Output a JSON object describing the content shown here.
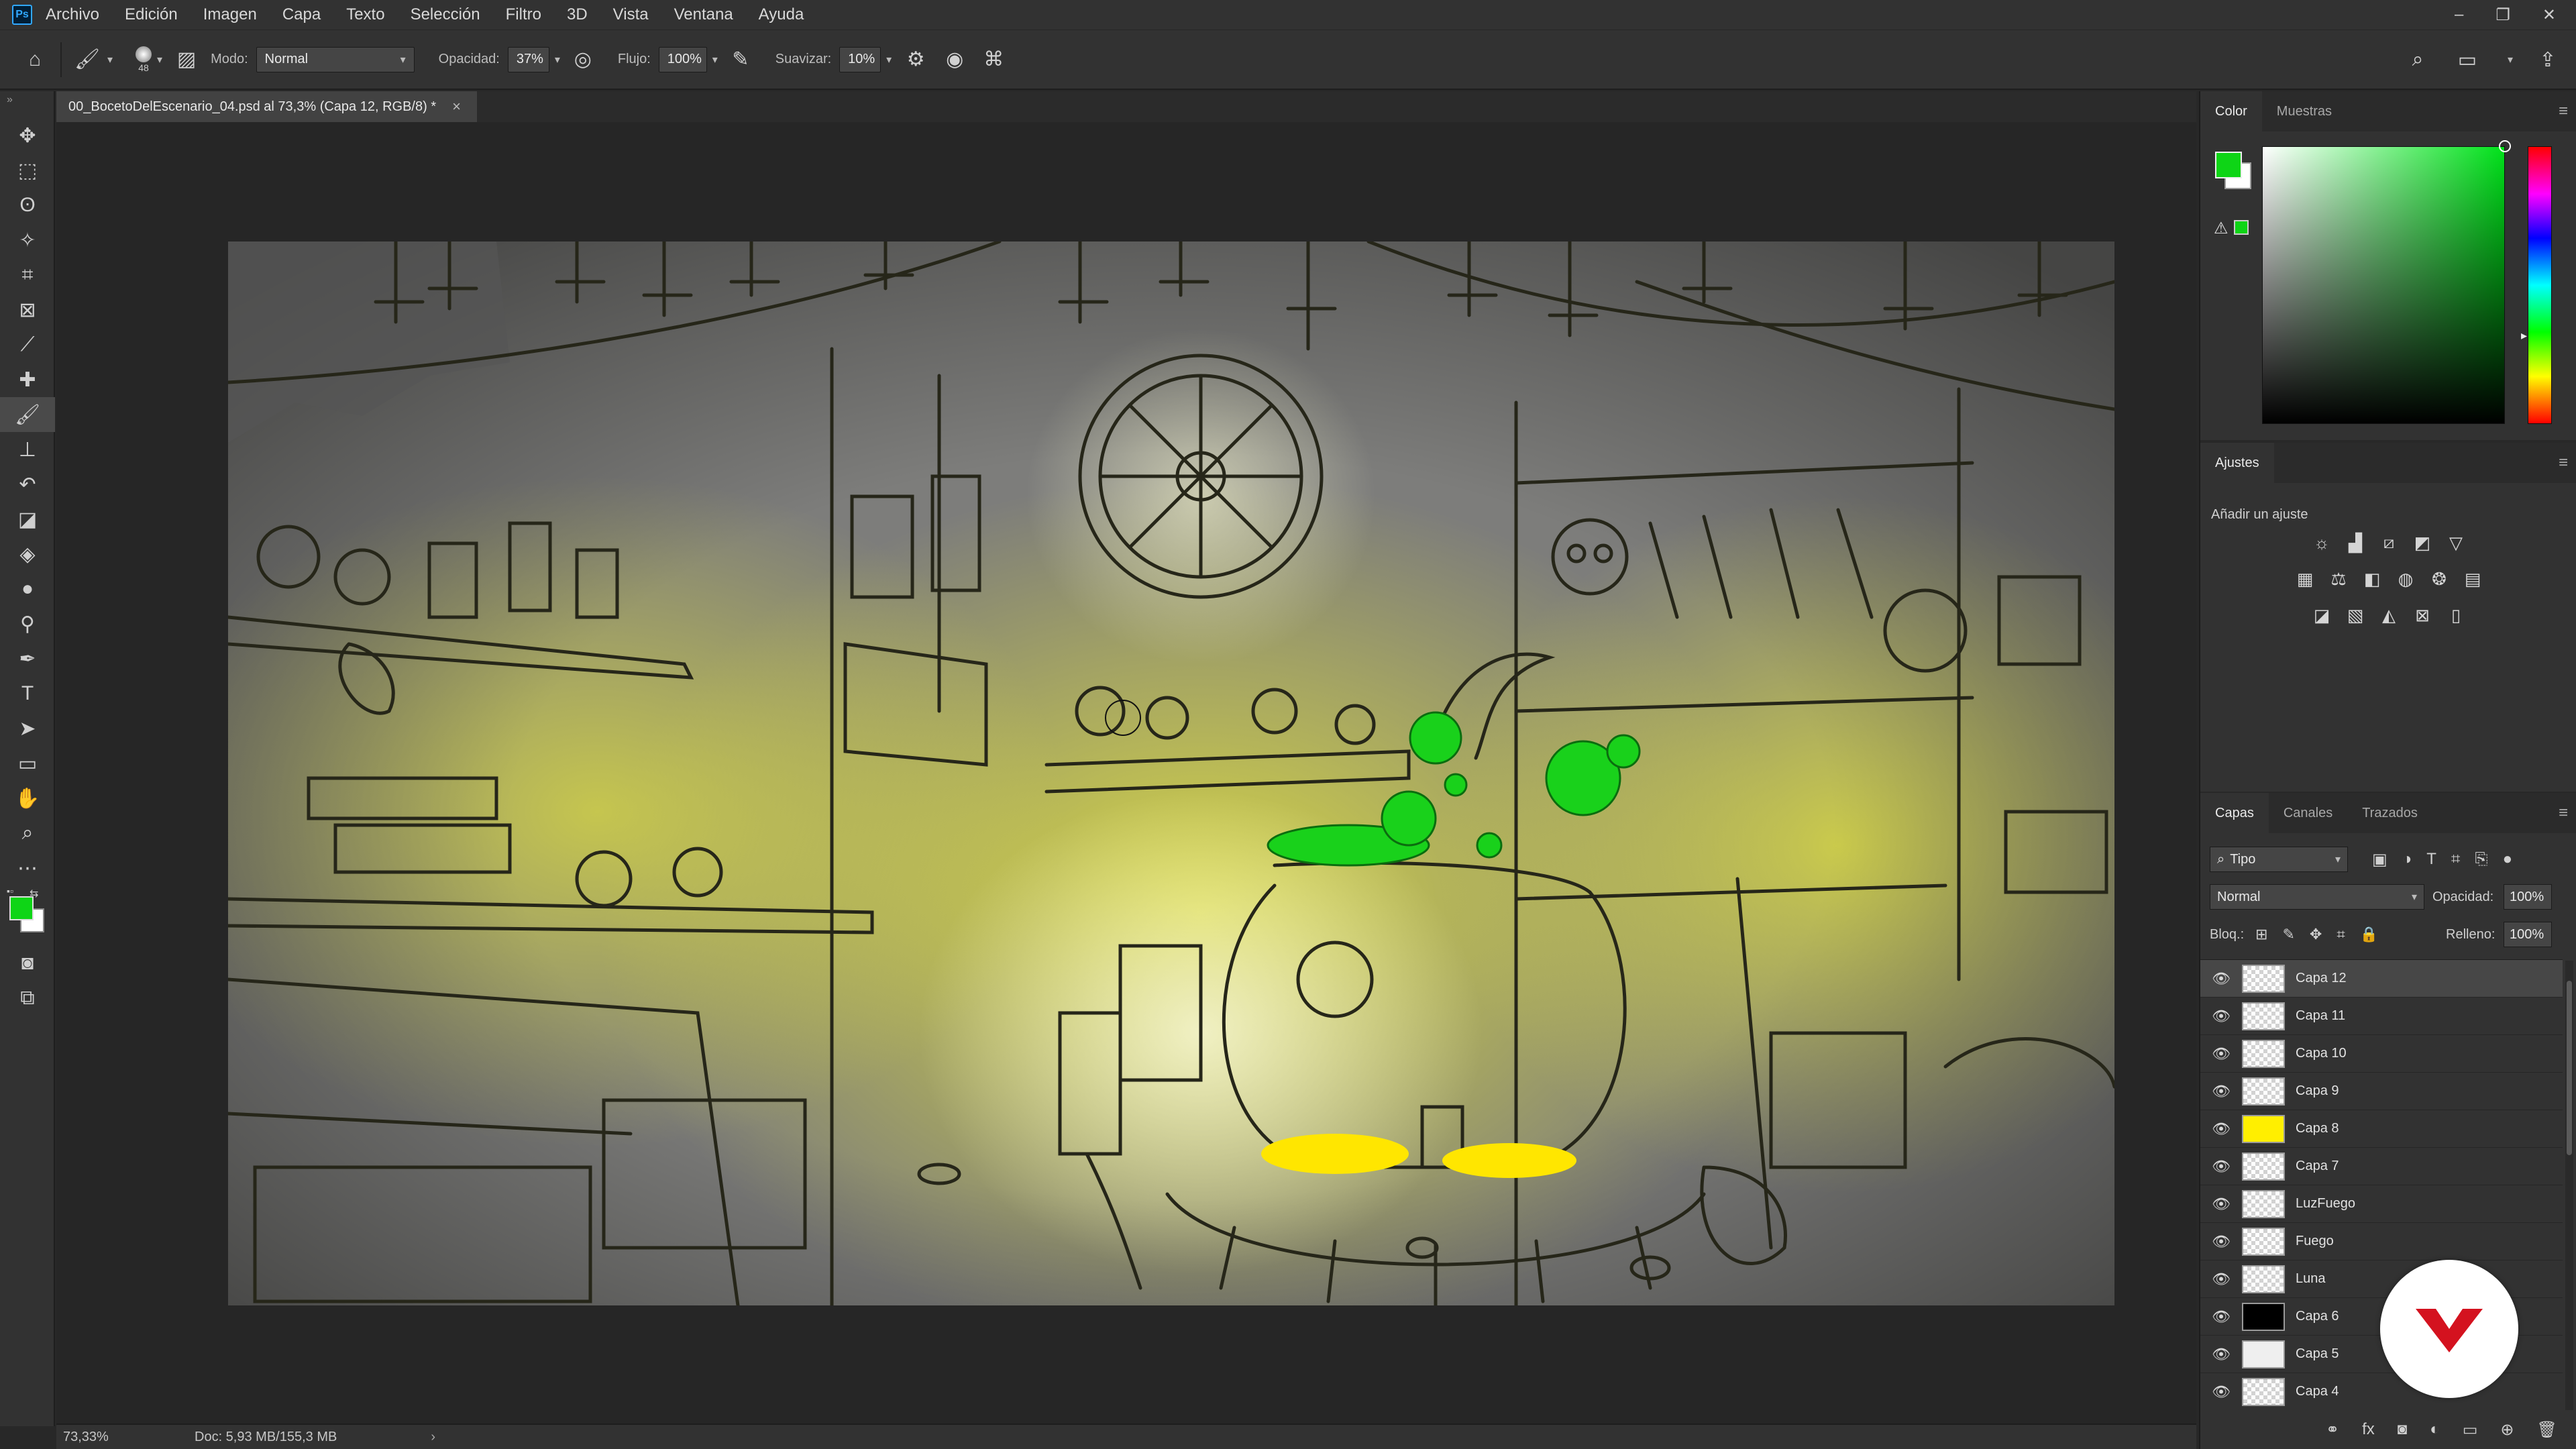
{
  "app": {
    "logo_text": "Ps",
    "menu": [
      "Archivo",
      "Edición",
      "Imagen",
      "Capa",
      "Texto",
      "Selección",
      "Filtro",
      "3D",
      "Vista",
      "Ventana",
      "Ayuda"
    ],
    "window_controls": {
      "minimize": "–",
      "restore": "❐",
      "close": "✕"
    }
  },
  "options_bar": {
    "brush_size": "48",
    "mode_label": "Modo:",
    "mode_value": "Normal",
    "opacity_label": "Opacidad:",
    "opacity_value": "37%",
    "flow_label": "Flujo:",
    "flow_value": "100%",
    "smoothing_label": "Suavizar:",
    "smoothing_value": "10%"
  },
  "document": {
    "tab_title": "00_BocetoDelEscenario_04.psd al 73,3% (Capa 12, RGB/8) *",
    "close_glyph": "×"
  },
  "status_bar": {
    "zoom": "73,33%",
    "doc_info": "Doc: 5,93 MB/155,3 MB",
    "arrow": "›"
  },
  "color_panel": {
    "tabs": [
      "Color",
      "Muestras"
    ],
    "foreground": "#0ed516",
    "background": "#ffffff"
  },
  "adjustments_panel": {
    "tab": "Ajustes",
    "title": "Añadir un ajuste"
  },
  "layers_panel": {
    "tabs": [
      "Capas",
      "Canales",
      "Trazados"
    ],
    "filter_label": "Tipo",
    "blend_mode": "Normal",
    "opacity_label": "Opacidad:",
    "opacity_value": "100%",
    "lock_label": "Bloq.:",
    "fill_label": "Relleno:",
    "fill_value": "100%",
    "layers": [
      {
        "name": "Capa 12",
        "thumb": "transparent",
        "selected": true
      },
      {
        "name": "Capa 11",
        "thumb": "transparent",
        "selected": false
      },
      {
        "name": "Capa 10",
        "thumb": "transparent",
        "selected": false
      },
      {
        "name": "Capa 9",
        "thumb": "transparent",
        "selected": false
      },
      {
        "name": "Capa 8",
        "thumb": "yellow",
        "selected": false
      },
      {
        "name": "Capa 7",
        "thumb": "transparent",
        "selected": false
      },
      {
        "name": "LuzFuego",
        "thumb": "transparent",
        "selected": false
      },
      {
        "name": "Fuego",
        "thumb": "transparent",
        "selected": false
      },
      {
        "name": "Luna",
        "thumb": "transparent",
        "selected": false
      },
      {
        "name": "Capa 6",
        "thumb": "black",
        "selected": false
      },
      {
        "name": "Capa 5",
        "thumb": "sketch",
        "selected": false
      },
      {
        "name": "Capa 4",
        "thumb": "transparent",
        "selected": false
      }
    ]
  },
  "theme": {
    "accent_green": "#0ed516",
    "glow_yellow": "#e8e83a",
    "panel_bg": "#323232",
    "canvas_bg": "#262626"
  }
}
